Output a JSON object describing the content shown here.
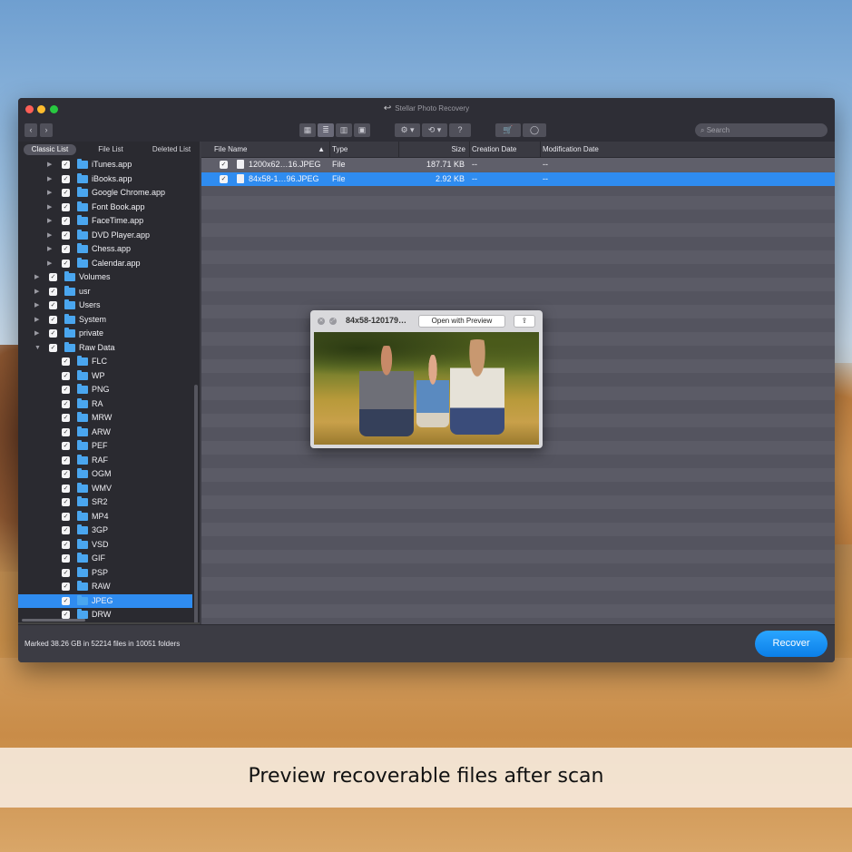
{
  "window": {
    "title": "Stellar Photo Recovery"
  },
  "toolbar": {
    "back": "‹",
    "forward": "›",
    "view_modes": [
      "grid-view-icon",
      "list-view-icon",
      "column-view-icon",
      "coverflow-view-icon"
    ],
    "settings": "⚙ ▾",
    "history": "⟲ ▾",
    "help": "?",
    "cart": "🛒",
    "user": "◯",
    "search_placeholder": "Search"
  },
  "tabs": [
    "Classic List",
    "File List",
    "Deleted List"
  ],
  "sidebar": {
    "items": [
      {
        "label": "iTunes.app",
        "expandable": true
      },
      {
        "label": "iBooks.app",
        "expandable": true
      },
      {
        "label": "Google Chrome.app",
        "expandable": true
      },
      {
        "label": "Font Book.app",
        "expandable": true
      },
      {
        "label": "FaceTime.app",
        "expandable": true
      },
      {
        "label": "DVD Player.app",
        "expandable": true
      },
      {
        "label": "Chess.app",
        "expandable": true
      },
      {
        "label": "Calendar.app",
        "expandable": true
      },
      {
        "label": "Volumes",
        "expandable": true
      },
      {
        "label": "usr",
        "expandable": true
      },
      {
        "label": "Users",
        "expandable": true
      },
      {
        "label": "System",
        "expandable": true
      },
      {
        "label": "private",
        "expandable": true
      },
      {
        "label": "Raw Data",
        "expandable": true,
        "expanded": true
      },
      {
        "label": "FLC"
      },
      {
        "label": "WP"
      },
      {
        "label": "PNG"
      },
      {
        "label": "RA"
      },
      {
        "label": "MRW"
      },
      {
        "label": "ARW"
      },
      {
        "label": "PEF"
      },
      {
        "label": "RAF"
      },
      {
        "label": "OGM"
      },
      {
        "label": "WMV"
      },
      {
        "label": "SR2"
      },
      {
        "label": "MP4"
      },
      {
        "label": "3GP"
      },
      {
        "label": "VSD"
      },
      {
        "label": "GIF"
      },
      {
        "label": "PSP"
      },
      {
        "label": "RAW"
      },
      {
        "label": "JPEG",
        "selected": true
      },
      {
        "label": "DRW"
      }
    ]
  },
  "table": {
    "columns": [
      "File Name",
      "Type",
      "Size",
      "Creation Date",
      "Modification Date"
    ],
    "rows": [
      {
        "name": "1200x62…16.JPEG",
        "type": "File",
        "size": "187.71 KB",
        "created": "--",
        "modified": "--"
      },
      {
        "name": "84x58-1…96.JPEG",
        "type": "File",
        "size": "2.92 KB",
        "created": "--",
        "modified": "--",
        "selected": true
      }
    ]
  },
  "preview": {
    "title": "84x58-120179…",
    "open_button": "Open with Preview",
    "share": "⇪"
  },
  "status": "Marked 38.26 GB in 52214 files in 10051 folders",
  "recover_button": "Recover",
  "caption": "Preview recoverable files after scan"
}
